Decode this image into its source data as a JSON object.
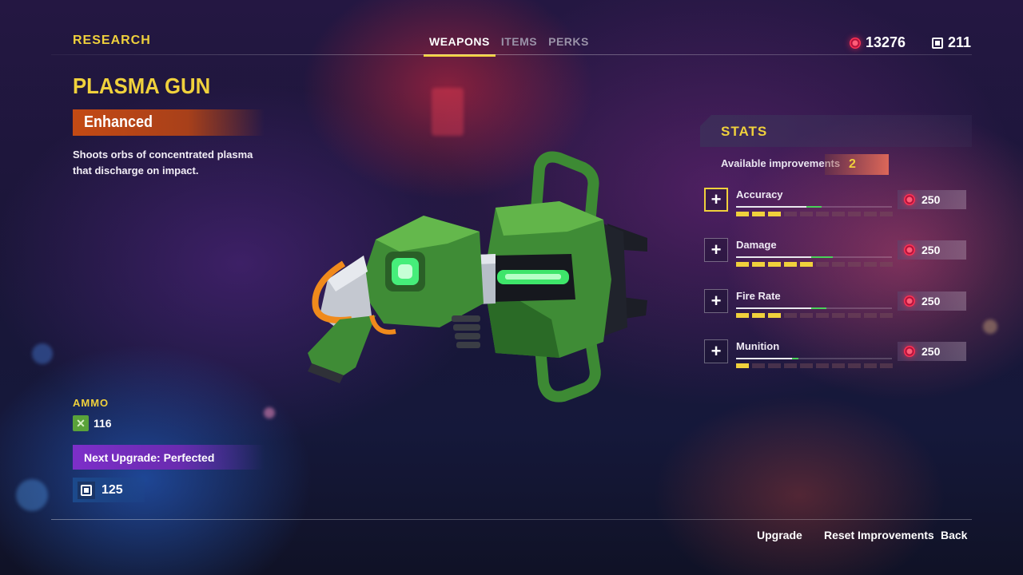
{
  "header": {
    "title": "RESEARCH",
    "tabs": [
      {
        "label": "WEAPONS",
        "active": true
      },
      {
        "label": "ITEMS",
        "active": false
      },
      {
        "label": "PERKS",
        "active": false
      }
    ],
    "currency": {
      "credits": "13276",
      "chips": "211"
    }
  },
  "weapon": {
    "name": "PLASMA GUN",
    "tier": "Enhanced",
    "description": "Shoots orbs of concentrated plasma that discharge on impact."
  },
  "ammo": {
    "title": "AMMO",
    "count": "116",
    "icon": "ammo-icon"
  },
  "next_upgrade": {
    "label": "Next Upgrade: Perfected",
    "cost": "125",
    "icon": "chip-icon"
  },
  "stats": {
    "title": "STATS",
    "available_label": "Available improvements",
    "available_value": "2",
    "items": [
      {
        "name": "Accuracy",
        "cost": "250",
        "level": 3,
        "max_level": 10,
        "bar_base": 0.45,
        "bar_bonus": 0.1,
        "focused": true
      },
      {
        "name": "Damage",
        "cost": "250",
        "level": 5,
        "max_level": 10,
        "bar_base": 0.48,
        "bar_bonus": 0.14,
        "focused": false
      },
      {
        "name": "Fire Rate",
        "cost": "250",
        "level": 3,
        "max_level": 10,
        "bar_base": 0.48,
        "bar_bonus": 0.1,
        "focused": false
      },
      {
        "name": "Munition",
        "cost": "250",
        "level": 1,
        "max_level": 10,
        "bar_base": 0.36,
        "bar_bonus": 0.04,
        "focused": false
      }
    ]
  },
  "footer": {
    "upgrade": "Upgrade",
    "reset": "Reset Improvements",
    "back": "Back"
  },
  "colors": {
    "accent_yellow": "#f0d13c",
    "tier_orange": "#c44a14",
    "upgrade_purple": "#7d2fc9",
    "stat_green": "#4bd05a",
    "coin_red": "#ff3355"
  }
}
